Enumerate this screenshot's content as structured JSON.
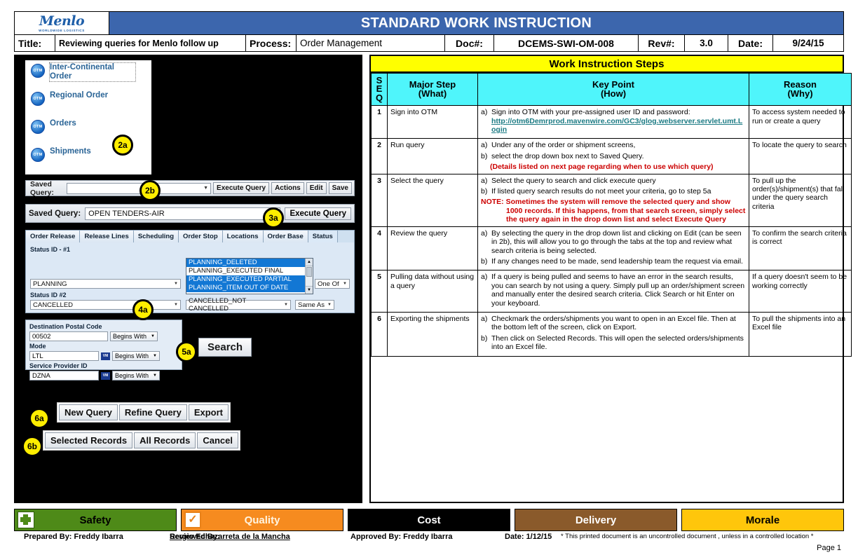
{
  "header": {
    "logo_word": "Menlo",
    "logo_sub": "worldwide logistics",
    "banner_title": "STANDARD WORK INSTRUCTION",
    "title_label": "Title:",
    "title_value": "Reviewing queries for Menlo follow up",
    "process_label": "Process:",
    "process_value": "Order Management",
    "doc_label": "Doc#:",
    "doc_value": "DCEMS-SWI-OM-008",
    "rev_label": "Rev#:",
    "rev_value": "3.0",
    "date_label": "Date:",
    "date_value": "9/24/15"
  },
  "screenshot": {
    "nav_items": [
      {
        "icon": "otm-icon",
        "label": "Inter-Continental Order",
        "selected": true
      },
      {
        "icon": "otm-icon",
        "label": "Regional Order",
        "selected": false
      },
      {
        "icon": "otm-icon",
        "label": "Orders",
        "selected": false
      },
      {
        "icon": "otm-icon",
        "label": "Shipments",
        "selected": false
      }
    ],
    "saved_query_bar1": {
      "label": "Saved Query:",
      "value": "",
      "buttons": [
        "Execute Query",
        "Actions",
        "Edit",
        "Save"
      ]
    },
    "saved_query_bar2": {
      "label": "Saved Query:",
      "value": "OPEN TENDERS-AIR",
      "button": "Execute Query"
    },
    "tabs": [
      "Order Release",
      "Release Lines",
      "Scheduling",
      "Order Stop",
      "Locations",
      "Order Base",
      "Status"
    ],
    "active_tab": "Status",
    "status_panel": {
      "status1_label": "Status ID - #1",
      "status1_value": "PLANNING",
      "status1_operator": "One Of",
      "listbox_items": [
        {
          "text": "PLANNING_DELETED",
          "selected": true
        },
        {
          "text": "PLANNING_EXECUTED   FINAL",
          "selected": false
        },
        {
          "text": "PLANNING_EXECUTED   PARTIAL",
          "selected": true
        },
        {
          "text": "PLANNING_ITEM OUT OF DATE",
          "selected": true
        }
      ],
      "status2_label": "Status ID  #2",
      "status2_value": "CANCELLED",
      "status2_value2": "CANCELLED_NOT CANCELLED",
      "status2_operator": "Same As"
    },
    "search_panel": {
      "fields": [
        {
          "label": "Destination Postal Code",
          "value": "00502",
          "operator": "Begins With",
          "has_vm": false
        },
        {
          "label": "Mode",
          "value": "LTL",
          "operator": "Begins With",
          "has_vm": true
        },
        {
          "label": "Service Provider ID",
          "value": "DZNA",
          "operator": "Begins With",
          "has_vm": true
        }
      ],
      "search_button": "Search"
    },
    "button_row_1": [
      "New Query",
      "Refine Query",
      "Export"
    ],
    "button_row_2": [
      "Selected Records",
      "All Records",
      "Cancel"
    ],
    "callouts": [
      "2a",
      "2b",
      "3a",
      "4a",
      "5a",
      "6a",
      "6b"
    ]
  },
  "table": {
    "title": "Work Instruction Steps",
    "columns": {
      "seq": "S E Q",
      "major": "Major Step\n(What)",
      "major_line1": "Major Step",
      "major_line2": "(What)",
      "key_line1": "Key Point",
      "key_line2": "(How)",
      "reason_line1": "Reason",
      "reason_line2": "(Why)"
    },
    "rows": [
      {
        "seq": "1",
        "major": "Sign into OTM",
        "points": [
          {
            "mark": "a)",
            "text": "Sign into OTM with your pre-assigned user ID and password:",
            "link": "http://otm6Demrprod.mavenwire.com/GC3/glog.webserver.servlet.umt.Login"
          }
        ],
        "reason": "To access system needed to run or create a query"
      },
      {
        "seq": "2",
        "major": "Run query",
        "points": [
          {
            "mark": "a)",
            "text": "Under any of the order or shipment screens,"
          },
          {
            "mark": "b)",
            "text": "select the drop down box next to Saved Query."
          },
          {
            "mark": "",
            "text": "(Details listed on next page regarding when to use which query)",
            "red": true
          }
        ],
        "reason": "To locate the query  to search"
      },
      {
        "seq": "3",
        "major": "Select the query",
        "points": [
          {
            "mark": "a)",
            "text": "Select the query to search and click execute query"
          },
          {
            "mark": "b)",
            "text": "If listed query search results do not meet your criteria, go to step 5a"
          },
          {
            "mark": "",
            "text": "NOTE: Sometimes the system will remove the selected query and show 1000 records. If this happens, from that search screen, simply select the query again in the drop down list and select Execute Query",
            "red": true
          }
        ],
        "reason": "To pull up the order(s)/shipment(s) that fall under the query search criteria"
      },
      {
        "seq": "4",
        "major": "Review the query",
        "points": [
          {
            "mark": "a)",
            "text": "By selecting the query in the drop down list and clicking on Edit (can be seen in 2b), this will allow you to go through the tabs at the top and review what search criteria is being selected."
          },
          {
            "mark": "b)",
            "text": "If any changes need to be made, send leadership team the request via email."
          }
        ],
        "reason": "To confirm the search criteria is correct"
      },
      {
        "seq": "5",
        "major": "Pulling data without using a query",
        "points": [
          {
            "mark": "a)",
            "text": "If a query is being pulled and seems to have an error in the search results, you can search by not using a query. Simply pull up an order/shipment screen and manually enter the desired search criteria.  Click Search or hit Enter on your keyboard."
          }
        ],
        "reason": "If a query doesn't seem to be working correctly"
      },
      {
        "seq": "6",
        "major": "Exporting the shipments",
        "points": [
          {
            "mark": "a)",
            "text": "Checkmark the orders/shipments you want to open in an Excel file. Then at the bottom left of the screen, click on Export."
          },
          {
            "mark": "b)",
            "text": "Then click on Selected Records. This will open the selected orders/shipments into an Excel file."
          }
        ],
        "reason": "To pull the shipments into an Excel file"
      }
    ]
  },
  "footer": {
    "boxes": [
      {
        "label": "Safety",
        "bg": "#4e8a18",
        "color": "#000000",
        "icon": "first-aid-cross-icon"
      },
      {
        "label": "Quality",
        "bg": "#f68b1f",
        "color": "#fff4e0",
        "icon": "checkbox-icon"
      },
      {
        "label": "Cost",
        "bg": "#000000",
        "color": "#ffffff",
        "icon": ""
      },
      {
        "label": "Delivery",
        "bg": "#8a5a2b",
        "color": "#ffffff",
        "icon": ""
      },
      {
        "label": "Morale",
        "bg": "#ffc60b",
        "color": "#000000",
        "icon": ""
      }
    ],
    "prepared_by": "Prepared By:  Freddy Ibarra",
    "reviewed_by_label": "Reviewed By:",
    "reviewed_by_name": "Sergio Echazarreta de la Mancha",
    "approved_by": "Approved By: Freddy Ibarra",
    "date": "Date: 1/12/15",
    "disclaimer": "* This printed document is an uncontrolled document , unless in a controlled location *",
    "page": "Page 1"
  }
}
